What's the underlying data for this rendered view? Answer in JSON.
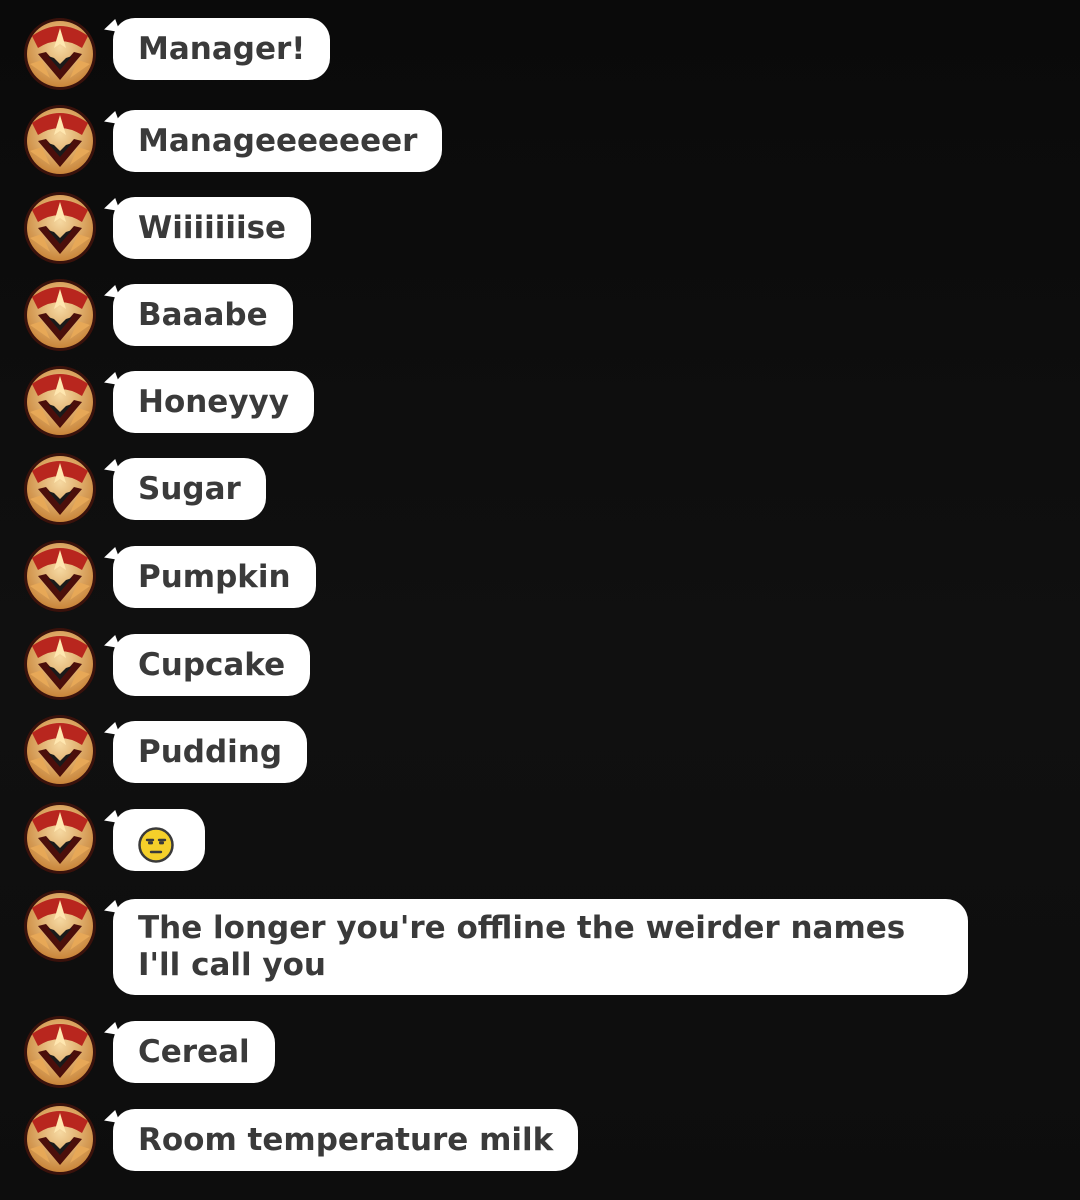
{
  "chat": {
    "messages": [
      {
        "text": "Manager!"
      },
      {
        "text": "Manageeeeeeer"
      },
      {
        "text": "Wiiiiiiise"
      },
      {
        "text": "Baaabe"
      },
      {
        "text": "Honeyyy"
      },
      {
        "text": "Sugar"
      },
      {
        "text": "Pumpkin"
      },
      {
        "text": "Cupcake"
      },
      {
        "text": "Pudding"
      },
      {
        "emoji": "unamused-face-icon"
      },
      {
        "text": "The longer you're offline the weirder names I'll call you"
      },
      {
        "text": "Cereal"
      },
      {
        "text": "Room temperature milk"
      }
    ]
  },
  "colors": {
    "background": "#0b0b0b",
    "bubble": "#ffffff",
    "bubble_text": "#3a3a3a",
    "avatar_red": "#b8261e",
    "avatar_gold": "#e8b25a",
    "emoji_yellow": "#f5d02a"
  }
}
